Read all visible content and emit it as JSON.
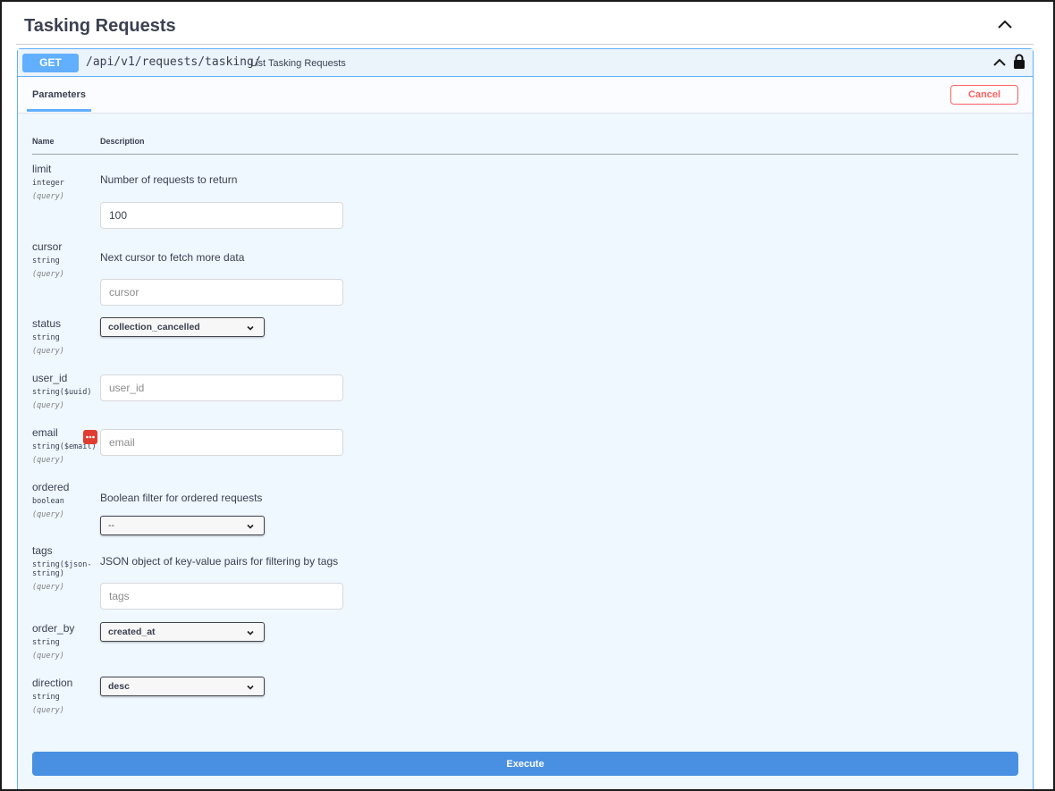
{
  "section": {
    "title": "Tasking Requests"
  },
  "operation": {
    "method": "GET",
    "path": "/api/v1/requests/tasking/",
    "summary": "List Tasking Requests"
  },
  "tabs": {
    "parameters": "Parameters",
    "cancel": "Cancel"
  },
  "columns": {
    "name": "Name",
    "description": "Description"
  },
  "params": {
    "limit": {
      "name": "limit",
      "type": "integer",
      "in": "(query)",
      "description": "Number of requests to return",
      "value": "100"
    },
    "cursor": {
      "name": "cursor",
      "type": "string",
      "in": "(query)",
      "description": "Next cursor to fetch more data",
      "placeholder": "cursor"
    },
    "status": {
      "name": "status",
      "type": "string",
      "in": "(query)",
      "selected": "collection_cancelled"
    },
    "user_id": {
      "name": "user_id",
      "type": "string($uuid)",
      "in": "(query)",
      "placeholder": "user_id"
    },
    "email": {
      "name": "email",
      "type": "string($email)",
      "in": "(query)",
      "placeholder": "email"
    },
    "ordered": {
      "name": "ordered",
      "type": "boolean",
      "in": "(query)",
      "description": "Boolean filter for ordered requests",
      "selected": "--"
    },
    "tags": {
      "name": "tags",
      "type_line1": "string($json-",
      "type_line2": "string)",
      "in": "(query)",
      "description": "JSON object of key-value pairs for filtering by tags",
      "placeholder": "tags"
    },
    "order_by": {
      "name": "order_by",
      "type": "string",
      "in": "(query)",
      "selected": "created_at"
    },
    "direction": {
      "name": "direction",
      "type": "string",
      "in": "(query)",
      "selected": "desc"
    }
  },
  "execute": {
    "label": "Execute"
  },
  "icons": {
    "section_toggle": "chevron-up-icon",
    "collapse": "chevron-up-icon",
    "lock": "lock-icon",
    "select_chevron": "chevron-down-icon",
    "extension": "extension-icon"
  },
  "colors": {
    "get_method": "#61affe",
    "cancel": "#ff6060",
    "execute": "#4990e2",
    "block_bg": "#eff7ff"
  }
}
